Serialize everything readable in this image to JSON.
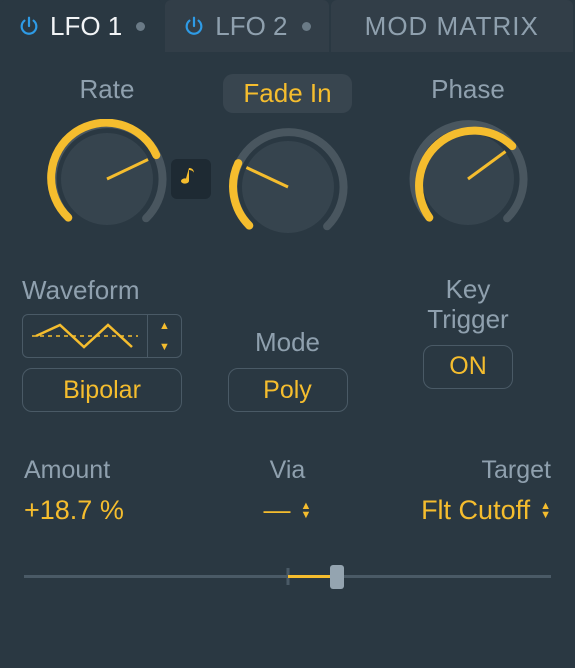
{
  "accent": "#f5bd2e",
  "tabs": {
    "lfo1": {
      "label": "LFO 1",
      "active": true,
      "powered": true
    },
    "lfo2": {
      "label": "LFO 2",
      "active": false,
      "powered": true
    },
    "mod": {
      "label": "MOD MATRIX"
    }
  },
  "knobs": {
    "rate": {
      "label": "Rate",
      "angle_deg": -25,
      "fill_from_deg": -135,
      "fill_to_deg": -25
    },
    "fadein": {
      "label": "Fade In",
      "angle_deg": -115,
      "fill_from_deg": -135,
      "fill_to_deg": -115,
      "highlighted": true
    },
    "phase": {
      "label": "Phase",
      "angle_deg": -35,
      "fill_from_deg": -135,
      "fill_to_deg": -35
    }
  },
  "sync_note_enabled": true,
  "waveform": {
    "label": "Waveform",
    "selected_shape": "triangle-bipolar"
  },
  "polarity": {
    "value": "Bipolar"
  },
  "mode": {
    "label": "Mode",
    "value": "Poly"
  },
  "key_trigger": {
    "label_line1": "Key",
    "label_line2": "Trigger",
    "value": "ON"
  },
  "routing": {
    "amount": {
      "label": "Amount",
      "value": "+18.7 %"
    },
    "via": {
      "label": "Via",
      "value": "—"
    },
    "target": {
      "label": "Target",
      "value": "Flt Cutoff"
    }
  },
  "slider": {
    "center_pct": 50,
    "value_pct": 59.3
  }
}
